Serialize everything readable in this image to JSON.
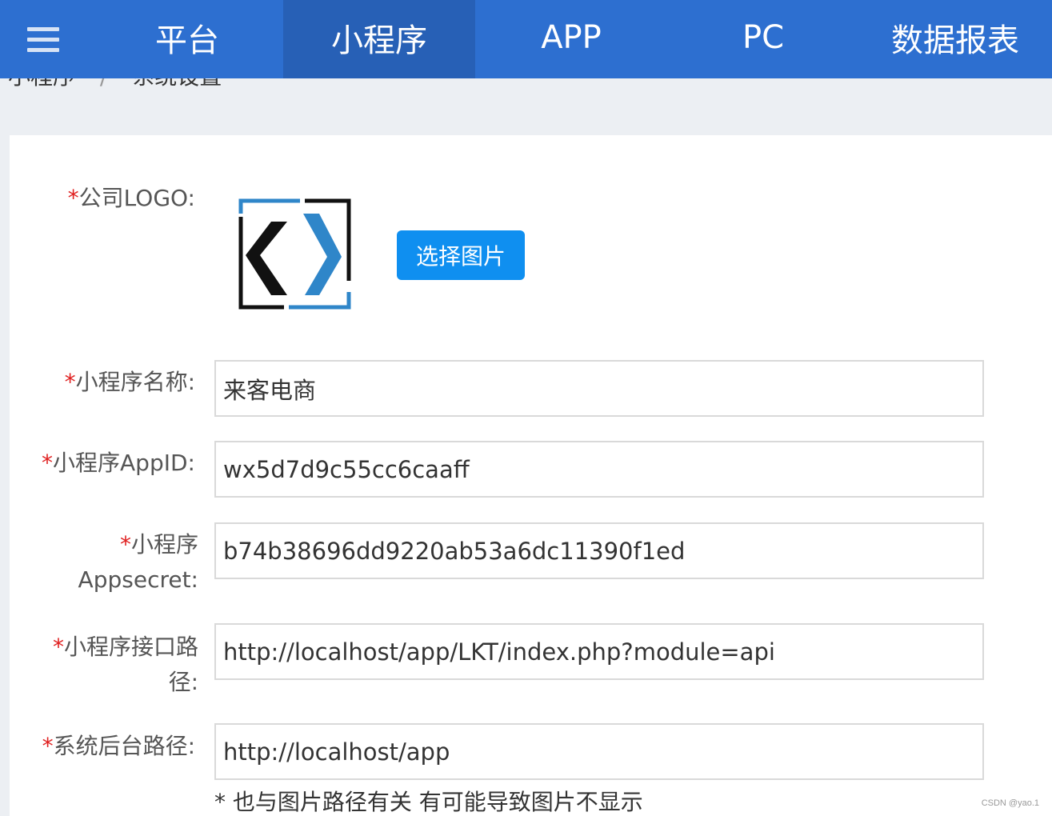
{
  "nav": {
    "items": [
      {
        "label": "平台",
        "active": false
      },
      {
        "label": "小程序",
        "active": true
      },
      {
        "label": "APP",
        "active": false
      },
      {
        "label": "PC",
        "active": false
      },
      {
        "label": "数据报表",
        "active": false
      }
    ],
    "accent": "#2d6fd0",
    "active_bg": "#2760b6"
  },
  "breadcrumb": {
    "parent": "小程序",
    "separator": "/",
    "current": "系统设置"
  },
  "form": {
    "required_mark": "*",
    "logo": {
      "label": "公司LOGO:",
      "button_label": "选择图片"
    },
    "fields": [
      {
        "label": "小程序名称:",
        "value": "来客电商"
      },
      {
        "label": "小程序AppID:",
        "value": "wx5d7d9c55cc6caaff"
      },
      {
        "label": "小程序Appsecret:",
        "value": "b74b38696dd9220ab53a6dc11390f1ed"
      },
      {
        "label": "小程序接口路径:",
        "value": "http://localhost/app/LKT/index.php?module=api"
      },
      {
        "label": "系统后台路径:",
        "value": "http://localhost/app"
      }
    ],
    "hint": "* 也与图片路径有关 有可能导致图片不显示"
  },
  "watermark": "CSDN @yao.1",
  "colors": {
    "button": "#0f8ff0",
    "required": "#e02020",
    "logo_blue": "#2f86c9"
  }
}
